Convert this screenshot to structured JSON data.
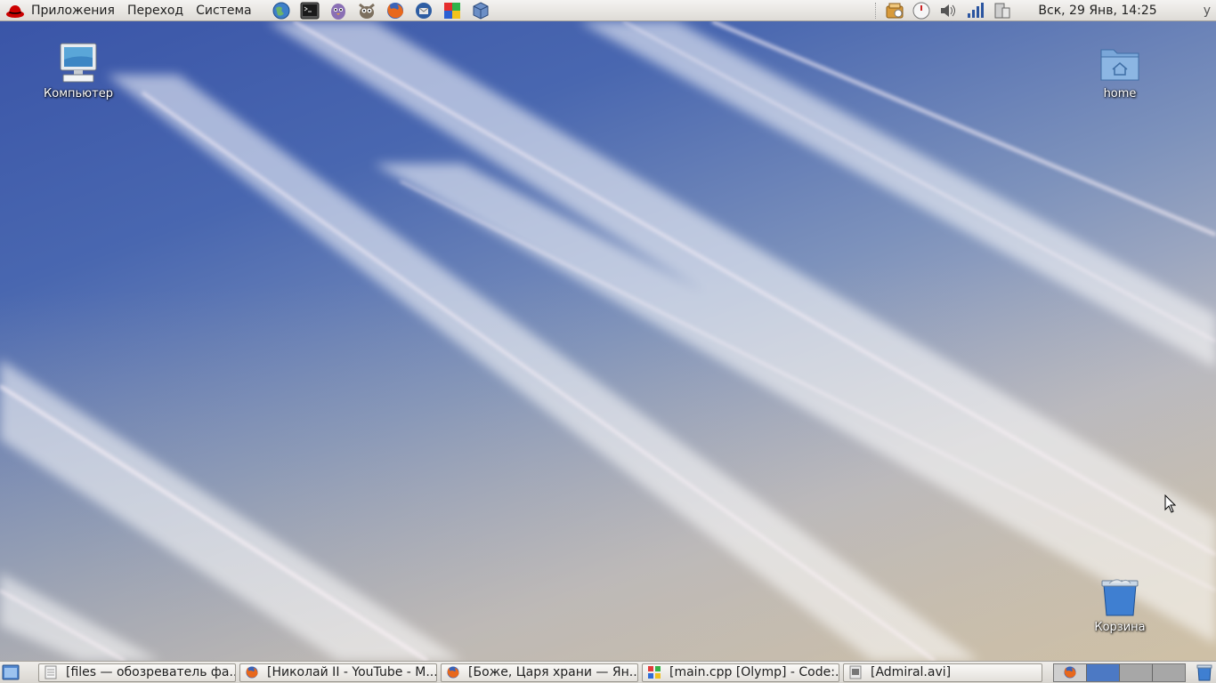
{
  "top_panel": {
    "menus": [
      {
        "label": "Приложения"
      },
      {
        "label": "Переход"
      },
      {
        "label": "Система"
      }
    ],
    "launchers": [
      "web-browser-icon",
      "terminal-icon",
      "pidgin-icon",
      "gimp-icon",
      "firefox-icon",
      "thunderbird-icon",
      "color-apps-icon",
      "virtualbox-icon"
    ],
    "tray": [
      "update-notifier-icon",
      "clock-applet-icon",
      "volume-icon",
      "network-signal-icon",
      "power-icon"
    ],
    "clock": "Вск, 29 Янв, 14:25",
    "user_initial": "y"
  },
  "desktop": {
    "icons": {
      "computer": "Компьютер",
      "home": "home",
      "trash": "Корзина"
    }
  },
  "bottom_panel": {
    "tasks": [
      {
        "label": "[files — обозреватель фа...",
        "icon": "file-manager-icon"
      },
      {
        "label": "[Николай II - YouTube - M...",
        "icon": "firefox-icon"
      },
      {
        "label": "[Боже, Царя храни — Ян...",
        "icon": "firefox-icon"
      },
      {
        "label": "[main.cpp [Olymp] - Code:...",
        "icon": "codeblocks-icon"
      },
      {
        "label": "[Admiral.avi]",
        "icon": "video-icon"
      }
    ],
    "workspaces": 4,
    "active_workspace": 2
  },
  "colors": {
    "panel_bg": "#dedbd6",
    "desktop_blue": "#3a55a8",
    "workspace_active": "#4c79c4"
  }
}
